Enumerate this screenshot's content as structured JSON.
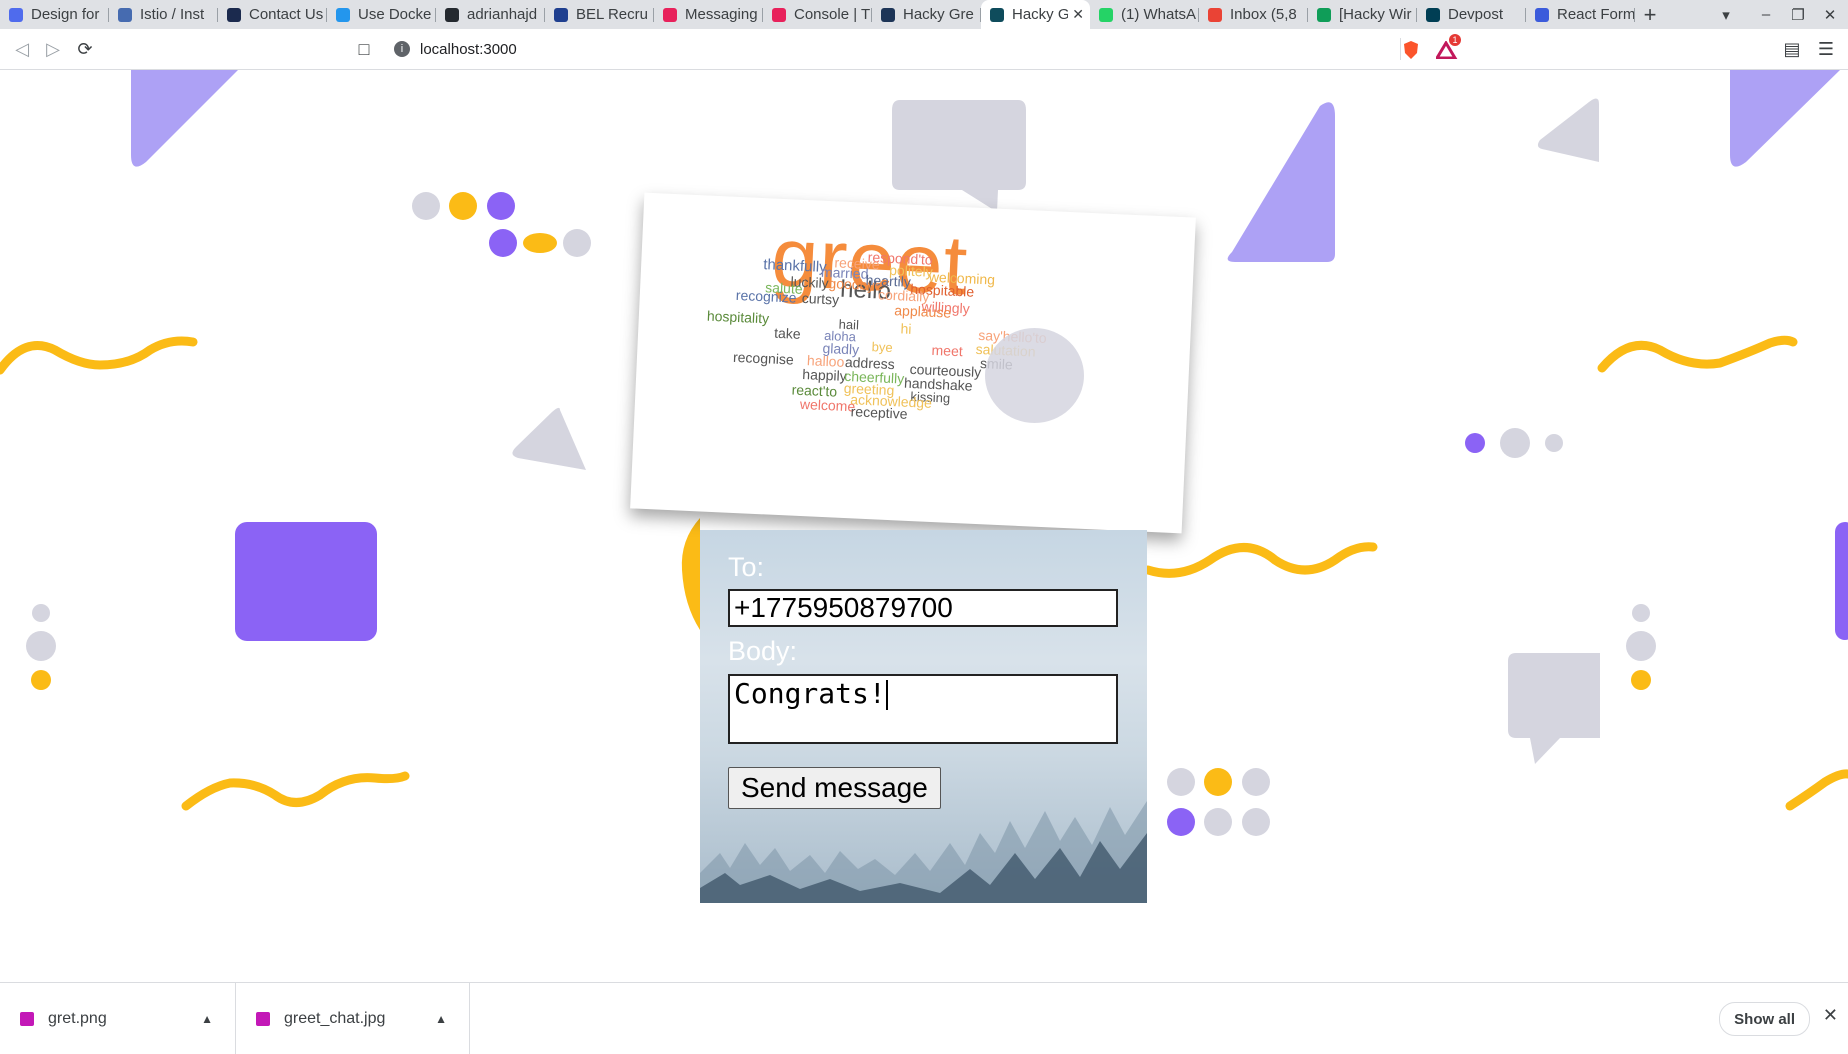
{
  "browser": {
    "tabs": [
      {
        "label": "Design for",
        "favicon_color": "#4f6bed"
      },
      {
        "label": "Istio / Inst",
        "favicon_color": "#466bb0"
      },
      {
        "label": "Contact Us",
        "favicon_color": "#1b2a4e"
      },
      {
        "label": "Use Docke",
        "favicon_color": "#2396ed"
      },
      {
        "label": "adrianhajd",
        "favicon_color": "#24292f"
      },
      {
        "label": "BEL Recru",
        "favicon_color": "#1f3f8f"
      },
      {
        "label": "Messaging",
        "favicon_color": "#e8215b"
      },
      {
        "label": "Console | T",
        "favicon_color": "#e8215b"
      },
      {
        "label": "Hacky Gre",
        "favicon_color": "#1d3557"
      },
      {
        "label": "Hacky G",
        "favicon_color": "#0f4c5c",
        "active": true
      },
      {
        "label": "(1) WhatsA",
        "favicon_color": "#25d366"
      },
      {
        "label": "Inbox (5,8",
        "favicon_color": "#ea4335"
      },
      {
        "label": "[Hacky Wir",
        "favicon_color": "#0f9d58"
      },
      {
        "label": "Devpost",
        "favicon_color": "#003e54"
      },
      {
        "label": "React Form",
        "favicon_color": "#3b5bdb"
      }
    ],
    "url": "localhost:3000",
    "brave_badge": "1"
  },
  "form": {
    "to_label": "To:",
    "to_value": "+1775950879700",
    "body_label": "Body:",
    "body_value": "Congrats!",
    "send_label": "Send message"
  },
  "wordcloud": {
    "words": [
      {
        "t": "greet",
        "c": "#f58c3c"
      },
      {
        "t": "hello",
        "c": "#555555"
      },
      {
        "t": "respond'to",
        "c": "#f0766b"
      },
      {
        "t": "receive",
        "c": "#f7a37a"
      },
      {
        "t": "thankfully",
        "c": "#5a73a8"
      },
      {
        "t": "married",
        "c": "#7a84b8"
      },
      {
        "t": "heartily",
        "c": "#5a6b93"
      },
      {
        "t": "politely",
        "c": "#f0c25a"
      },
      {
        "t": "welcoming",
        "c": "#f0b84a"
      },
      {
        "t": "luckily",
        "c": "#555555"
      },
      {
        "t": "goodbye",
        "c": "#f08a4a"
      },
      {
        "t": "hospitable",
        "c": "#e06030"
      },
      {
        "t": "salute",
        "c": "#7ab65a"
      },
      {
        "t": "cordially",
        "c": "#f7a37a"
      },
      {
        "t": "recognize",
        "c": "#5a73a8"
      },
      {
        "t": "curtsy",
        "c": "#555555"
      },
      {
        "t": "willingly",
        "c": "#f0766b"
      },
      {
        "t": "applause",
        "c": "#f08a4a"
      },
      {
        "t": "hospitality",
        "c": "#5a8a3a"
      },
      {
        "t": "hail",
        "c": "#555555"
      },
      {
        "t": "take",
        "c": "#555555"
      },
      {
        "t": "aloha",
        "c": "#7a84b8"
      },
      {
        "t": "hi",
        "c": "#f0c25a"
      },
      {
        "t": "say'hello'to",
        "c": "#f7a37a"
      },
      {
        "t": "salutation",
        "c": "#f0c25a"
      },
      {
        "t": "gladly",
        "c": "#7a84b8"
      },
      {
        "t": "bye",
        "c": "#f0c25a"
      },
      {
        "t": "meet",
        "c": "#f0766b"
      },
      {
        "t": "smile",
        "c": "#555555"
      },
      {
        "t": "recognise",
        "c": "#555555"
      },
      {
        "t": "halloo",
        "c": "#f7a37a"
      },
      {
        "t": "address",
        "c": "#555555"
      },
      {
        "t": "courteously",
        "c": "#555555"
      },
      {
        "t": "happily",
        "c": "#555555"
      },
      {
        "t": "cheerfully",
        "c": "#7ab65a"
      },
      {
        "t": "handshake",
        "c": "#555555"
      },
      {
        "t": "greeting",
        "c": "#f0c25a"
      },
      {
        "t": "react'to",
        "c": "#5a8a3a"
      },
      {
        "t": "kissing",
        "c": "#555555"
      },
      {
        "t": "acknowledge",
        "c": "#f0c25a"
      },
      {
        "t": "welcome",
        "c": "#f0766b"
      },
      {
        "t": "receptive",
        "c": "#555555"
      }
    ]
  },
  "downloads": {
    "items": [
      {
        "name": "gret.png"
      },
      {
        "name": "greet_chat.jpg"
      }
    ],
    "show_all": "Show all"
  },
  "colors": {
    "purple": "#8b63f5",
    "light_purple": "#ada1f5",
    "yellow": "#fbbb16",
    "gray": "#d5d5df"
  }
}
